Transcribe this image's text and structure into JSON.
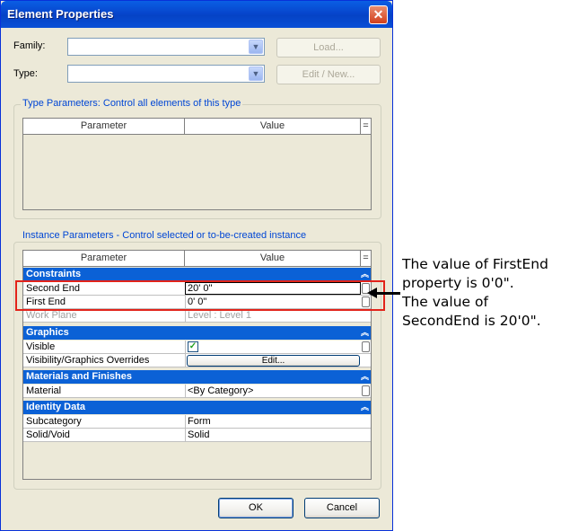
{
  "window": {
    "title": "Element Properties"
  },
  "family": {
    "label": "Family:",
    "value": "",
    "load_label": "Load..."
  },
  "type": {
    "label": "Type:",
    "value": "",
    "edit_new_label": "Edit / New..."
  },
  "type_params": {
    "title": "Type Parameters: Control all elements of this type",
    "col_parameter": "Parameter",
    "col_value": "Value",
    "col_eq": "="
  },
  "instance_params": {
    "title": "Instance Parameters - Control selected or to-be-created instance",
    "col_parameter": "Parameter",
    "col_value": "Value",
    "col_eq": "=",
    "categories": {
      "constraints": "Constraints",
      "graphics": "Graphics",
      "materials": "Materials and Finishes",
      "identity": "Identity Data"
    },
    "rows": {
      "second_end": {
        "name": "Second End",
        "value": "20'  0\""
      },
      "first_end": {
        "name": "First End",
        "value": "0'  0\""
      },
      "work_plane": {
        "name": "Work Plane",
        "value": "Level : Level 1"
      },
      "visible": {
        "name": "Visible",
        "checked": true
      },
      "vis_overrides": {
        "name": "Visibility/Graphics Overrides",
        "button": "Edit..."
      },
      "material": {
        "name": "Material",
        "value": "<By Category>"
      },
      "subcategory": {
        "name": "Subcategory",
        "value": "Form"
      },
      "solid_void": {
        "name": "Solid/Void",
        "value": "Solid"
      }
    }
  },
  "footer": {
    "ok_label": "OK",
    "cancel_label": "Cancel"
  },
  "annotation": {
    "line1": "The value of FirstEnd",
    "line2": "property is 0'0\".",
    "line3": "The value of",
    "line4": "SecondEnd is 20'0\"."
  },
  "colors": {
    "title_bar": "#0a5fe4",
    "category_header": "#0b61d6",
    "highlight_box": "#e2231a",
    "dialog_bg": "#ece9d8"
  }
}
